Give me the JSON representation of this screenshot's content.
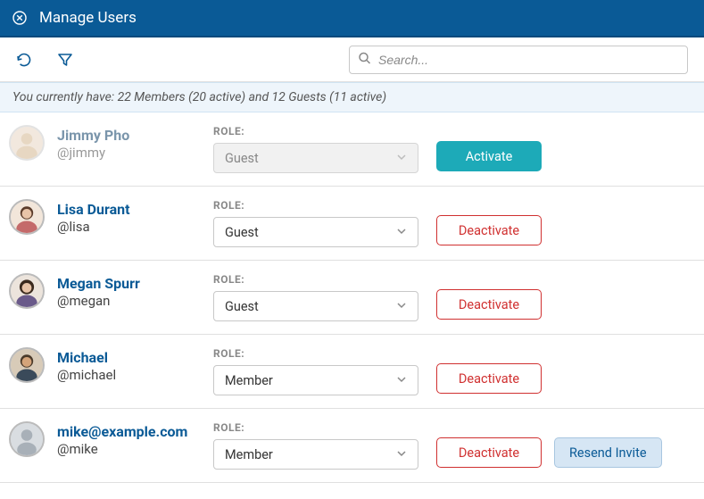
{
  "header": {
    "title": "Manage Users"
  },
  "toolbar": {
    "search_placeholder": "Search..."
  },
  "summary": {
    "text": "You currently have: 22 Members (20 active) and 12 Guests (11 active)"
  },
  "labels": {
    "role": "ROLE:",
    "activate": "Activate",
    "deactivate": "Deactivate",
    "resend_invite": "Resend Invite"
  },
  "users": [
    {
      "name": "Jimmy Pho",
      "handle": "@jimmy",
      "role": "Guest",
      "active": false,
      "avatar": "photo-warm",
      "resend": false
    },
    {
      "name": "Lisa Durant",
      "handle": "@lisa",
      "role": "Guest",
      "active": true,
      "avatar": "photo-f1",
      "resend": false
    },
    {
      "name": "Megan Spurr",
      "handle": "@megan",
      "role": "Guest",
      "active": true,
      "avatar": "photo-f2",
      "resend": false
    },
    {
      "name": "Michael",
      "handle": "@michael",
      "role": "Member",
      "active": true,
      "avatar": "photo-m1",
      "resend": false
    },
    {
      "name": "mike@example.com",
      "handle": "@mike",
      "role": "Member",
      "active": true,
      "avatar": "placeholder",
      "resend": true
    }
  ],
  "colors": {
    "header_bg": "#0a5a96",
    "accent_teal": "#1daab8",
    "danger": "#d03030",
    "info_bg": "#eef5fb",
    "resend_bg": "#d6e6f4"
  }
}
